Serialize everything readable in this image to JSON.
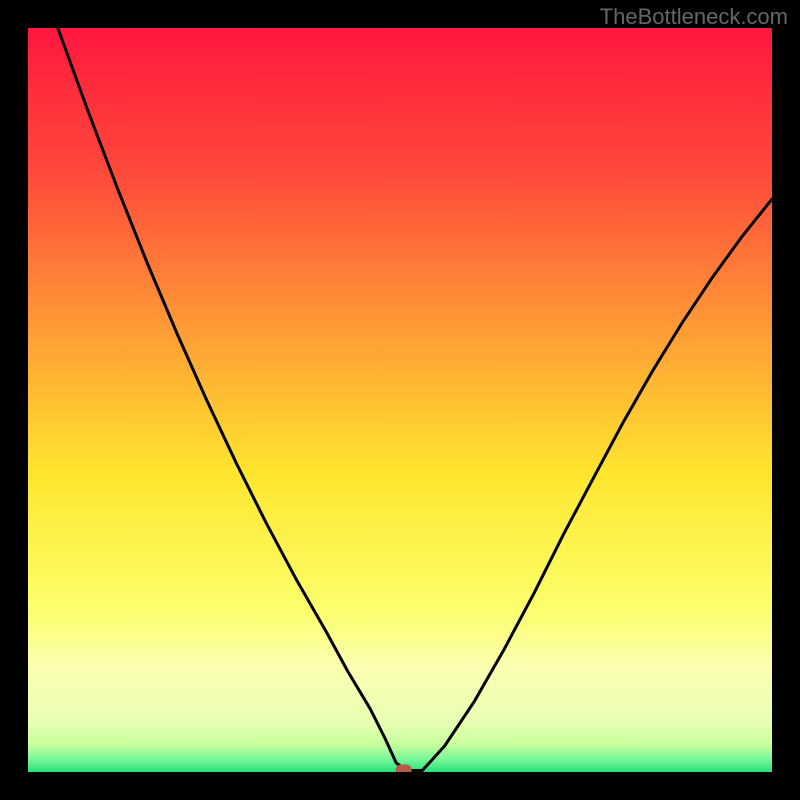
{
  "watermark": "TheBottleneck.com",
  "chart_data": {
    "type": "line",
    "title": "",
    "xlabel": "",
    "ylabel": "",
    "xlim": [
      0,
      100
    ],
    "ylim": [
      0,
      100
    ],
    "background_gradient": {
      "stops": [
        {
          "offset": 0.0,
          "color": "#ff173e"
        },
        {
          "offset": 0.2,
          "color": "#ff4b3b"
        },
        {
          "offset": 0.42,
          "color": "#ffa135"
        },
        {
          "offset": 0.6,
          "color": "#ffe62e"
        },
        {
          "offset": 0.78,
          "color": "#fbff6b"
        },
        {
          "offset": 0.86,
          "color": "#fcffb0"
        },
        {
          "offset": 0.93,
          "color": "#e9ffb4"
        },
        {
          "offset": 0.963,
          "color": "#c8ff9b"
        },
        {
          "offset": 0.982,
          "color": "#7cf79a"
        },
        {
          "offset": 1.0,
          "color": "#27e17b"
        }
      ]
    },
    "series": [
      {
        "name": "bottleneck-curve",
        "color": "#000000",
        "x": [
          4,
          8,
          12,
          16,
          20,
          24,
          28,
          32,
          36,
          40,
          43,
          46,
          48,
          49.5,
          51,
          53,
          56,
          60,
          64,
          68,
          72,
          76,
          80,
          84,
          88,
          92,
          96,
          100
        ],
        "y": [
          100,
          89,
          78.5,
          68.5,
          59,
          50,
          41.5,
          33.5,
          26,
          19,
          13.5,
          8.5,
          4.5,
          1.2,
          0.2,
          0.2,
          3.5,
          9.5,
          16.5,
          24,
          32,
          39.5,
          47,
          54,
          60.5,
          66.5,
          72,
          77
        ]
      }
    ],
    "trough_marker": {
      "x": 50.5,
      "y": 0.2,
      "color": "#b75a4a"
    }
  }
}
